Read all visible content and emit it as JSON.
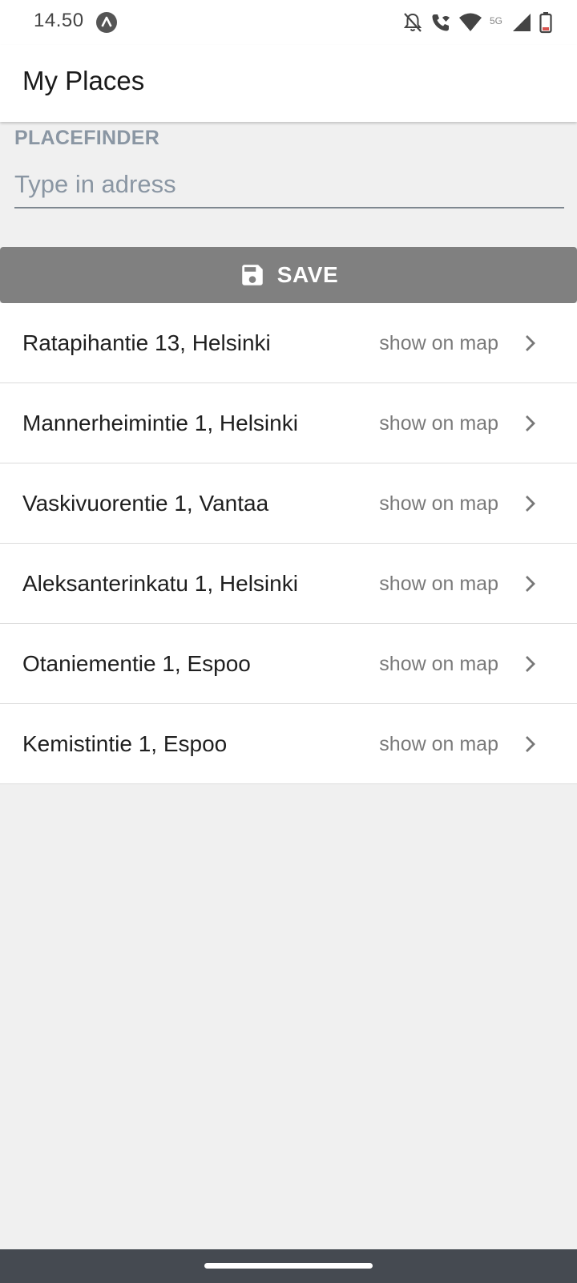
{
  "status_bar": {
    "time": "14.50",
    "icons": [
      "app-notification-icon",
      "notifications-off-icon",
      "wifi-calling-icon",
      "wifi-icon",
      "network-5g-icon",
      "cell-signal-icon",
      "battery-icon"
    ],
    "network_label": "5G"
  },
  "app_bar": {
    "title": "My Places"
  },
  "placefinder": {
    "label": "PLACEFINDER",
    "value": "",
    "placeholder": "Type in adress"
  },
  "save_button": {
    "label": "SAVE",
    "icon": "save-icon"
  },
  "places": [
    {
      "address": "Ratapihantie 13, Helsinki",
      "action": "show on map"
    },
    {
      "address": "Mannerheimintie 1, Helsinki",
      "action": "show on map"
    },
    {
      "address": "Vaskivuorentie 1, Vantaa",
      "action": "show on map"
    },
    {
      "address": "Aleksanterinkatu 1, Helsinki",
      "action": "show on map"
    },
    {
      "address": "Otaniementie 1, Espoo",
      "action": "show on map"
    },
    {
      "address": "Kemistintie 1, Espoo",
      "action": "show on map"
    }
  ],
  "colors": {
    "background": "#f0f0f0",
    "button": "#808080",
    "label": "#8a96a3",
    "nav_bar": "#454a51"
  }
}
